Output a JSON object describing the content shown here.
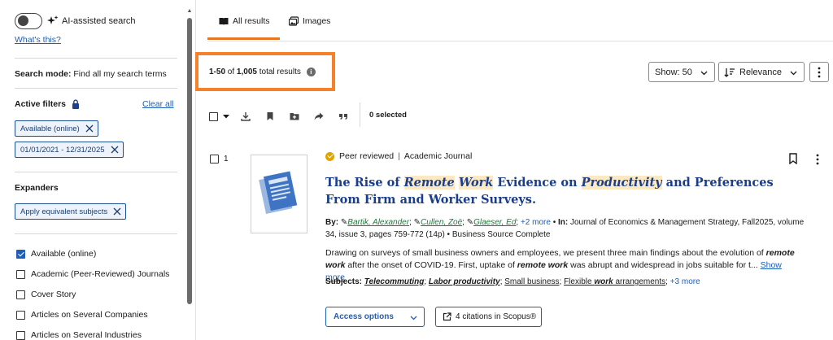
{
  "sidebar": {
    "ai_toggle_label": "AI-assisted search",
    "whats_this": "What's this?",
    "search_mode_label": "Search mode:",
    "search_mode_value": "Find all my search terms",
    "active_filters_label": "Active filters",
    "clear_all": "Clear all",
    "filters": [
      "Available (online)",
      "01/01/2021 - 12/31/2025"
    ],
    "expanders_label": "Expanders",
    "expander_chip": "Apply equivalent subjects",
    "limiters": [
      {
        "label": "Available (online)",
        "checked": true
      },
      {
        "label": "Academic (Peer-Reviewed) Journals",
        "checked": false
      },
      {
        "label": "Cover Story",
        "checked": false
      },
      {
        "label": "Articles on Several Companies",
        "checked": false
      },
      {
        "label": "Articles on Several Industries",
        "checked": false
      }
    ]
  },
  "tabs": [
    {
      "label": "All results",
      "active": true,
      "icon": "book-icon"
    },
    {
      "label": "Images",
      "active": false,
      "icon": "images-icon"
    }
  ],
  "results_summary": {
    "range": "1-50",
    "of": "of",
    "total": "1,005",
    "suffix": "total results"
  },
  "controls": {
    "show_label": "Show: 50",
    "sort_label": "Relevance"
  },
  "toolbar": {
    "selected": "0 selected"
  },
  "result": {
    "number": "1",
    "peer_reviewed": "Peer reviewed",
    "type": "Academic Journal",
    "title_parts": {
      "t1": "The Rise of ",
      "h1": "Remote",
      "t2": " ",
      "h2": "Work",
      "t3": " Evidence on ",
      "h3": "Productivity",
      "t4": " and Preferences From Firm and Worker Surveys."
    },
    "by_label": "By:",
    "authors": [
      "Bartik, Alexander",
      "Cullen, Zoë",
      "Glaeser, Ed"
    ],
    "authors_more": "+2 more",
    "in_label": "In:",
    "source": "Journal of Economics & Management Strategy, Fall2025, volume 34, issue 3, pages 759-772 (14p)",
    "database": "Business Source Complete",
    "abstract_parts": {
      "a1": "Drawing on surveys of small business owners and employees, we present three main findings about the evolution of ",
      "e1": "remote work",
      "a2": " after the onset of COVID-19. First, uptake of ",
      "e2": "remote work",
      "a3": " was abrupt and widespread in jobs suitable for t..."
    },
    "show_more": "Show more",
    "subjects_label": "Subjects:",
    "subjects": {
      "s1": "Telecommuting",
      "s2": "Labor productivity",
      "s3": "Small business",
      "s4a": "Flexible ",
      "s4b": "work",
      "s4c": " arrangements",
      "more": "+3 more"
    },
    "access_options": "Access options",
    "citations": "4 citations in Scopus®"
  }
}
